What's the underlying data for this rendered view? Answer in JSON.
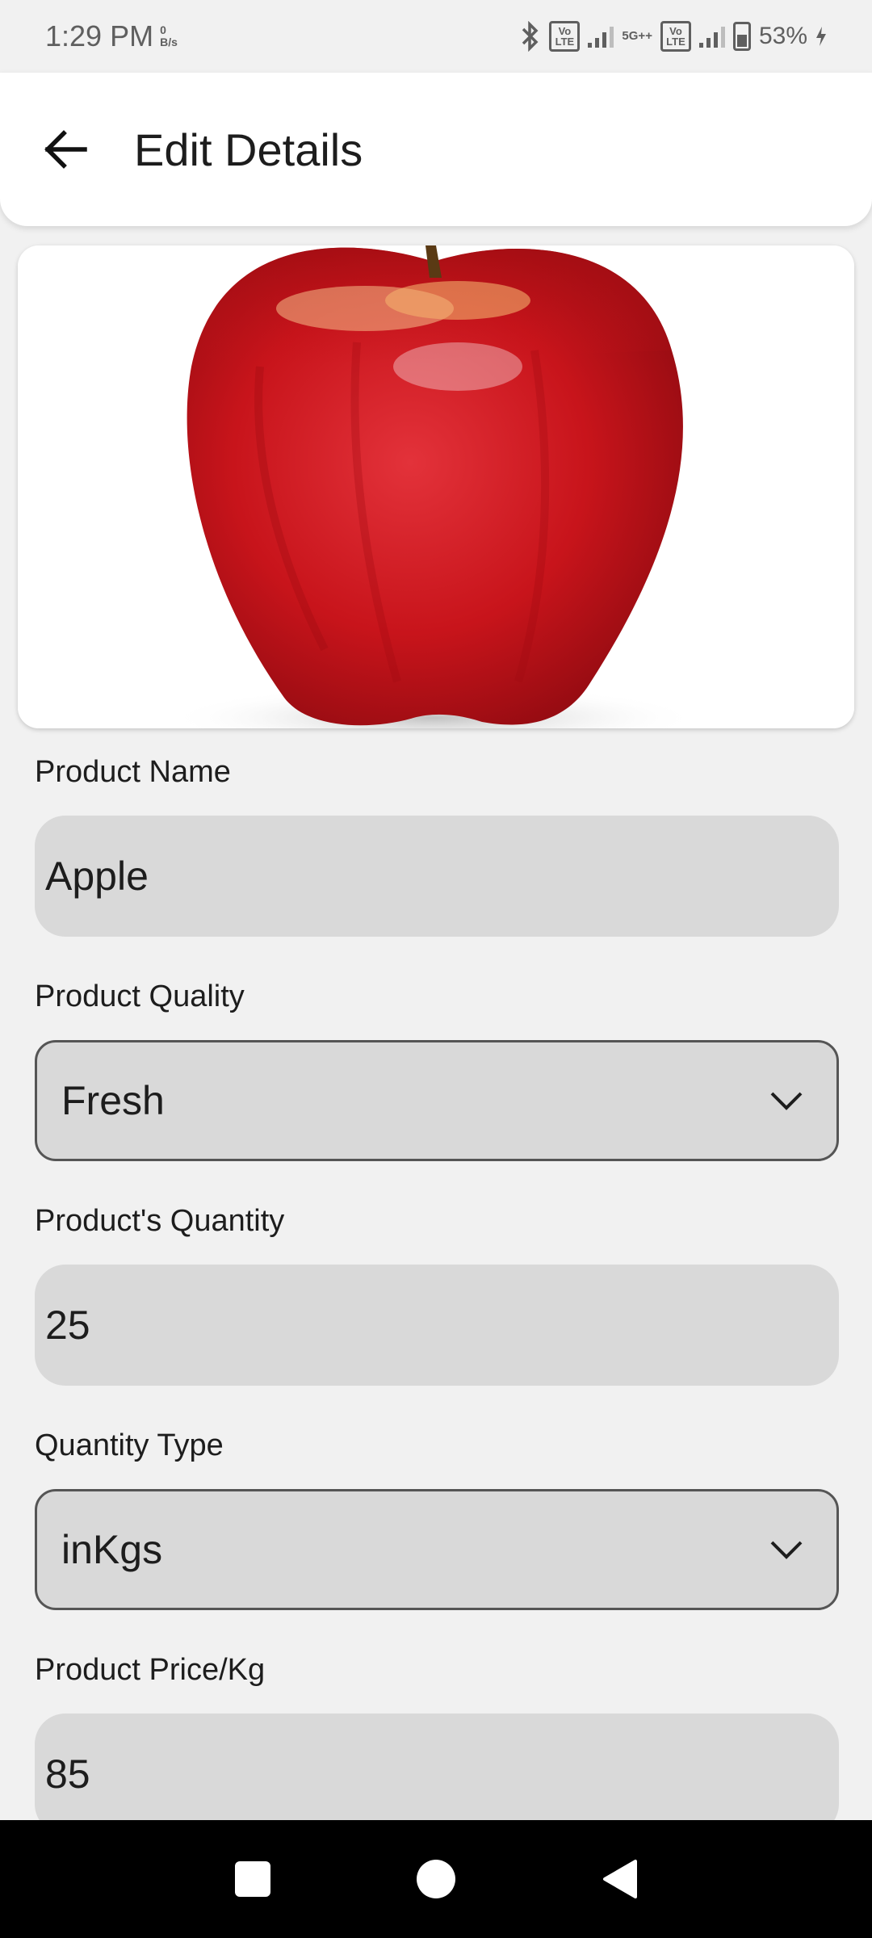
{
  "status_bar": {
    "time": "1:29 PM",
    "net_speed_value": "0",
    "net_speed_unit": "B/s",
    "volte_top": "Vo",
    "volte_bottom": "LTE",
    "network_type": "5G++",
    "battery": "53%"
  },
  "header": {
    "title": "Edit Details",
    "back_icon": "arrow-left-icon"
  },
  "product_image": {
    "icon": "apple-image"
  },
  "form": {
    "product_name": {
      "label": "Product Name",
      "value": "Apple"
    },
    "product_quality": {
      "label": "Product Quality",
      "value": "Fresh"
    },
    "product_quantity": {
      "label": "Product's Quantity",
      "value": "25"
    },
    "quantity_type": {
      "label": "Quantity Type",
      "value": "inKgs"
    },
    "product_price": {
      "label": "Product Price/Kg",
      "value": "85"
    }
  },
  "colors": {
    "background": "#f1f1f1",
    "field_fill": "#d9d9d9",
    "apple_red": "#c8141b",
    "nav_bar": "#000000"
  }
}
